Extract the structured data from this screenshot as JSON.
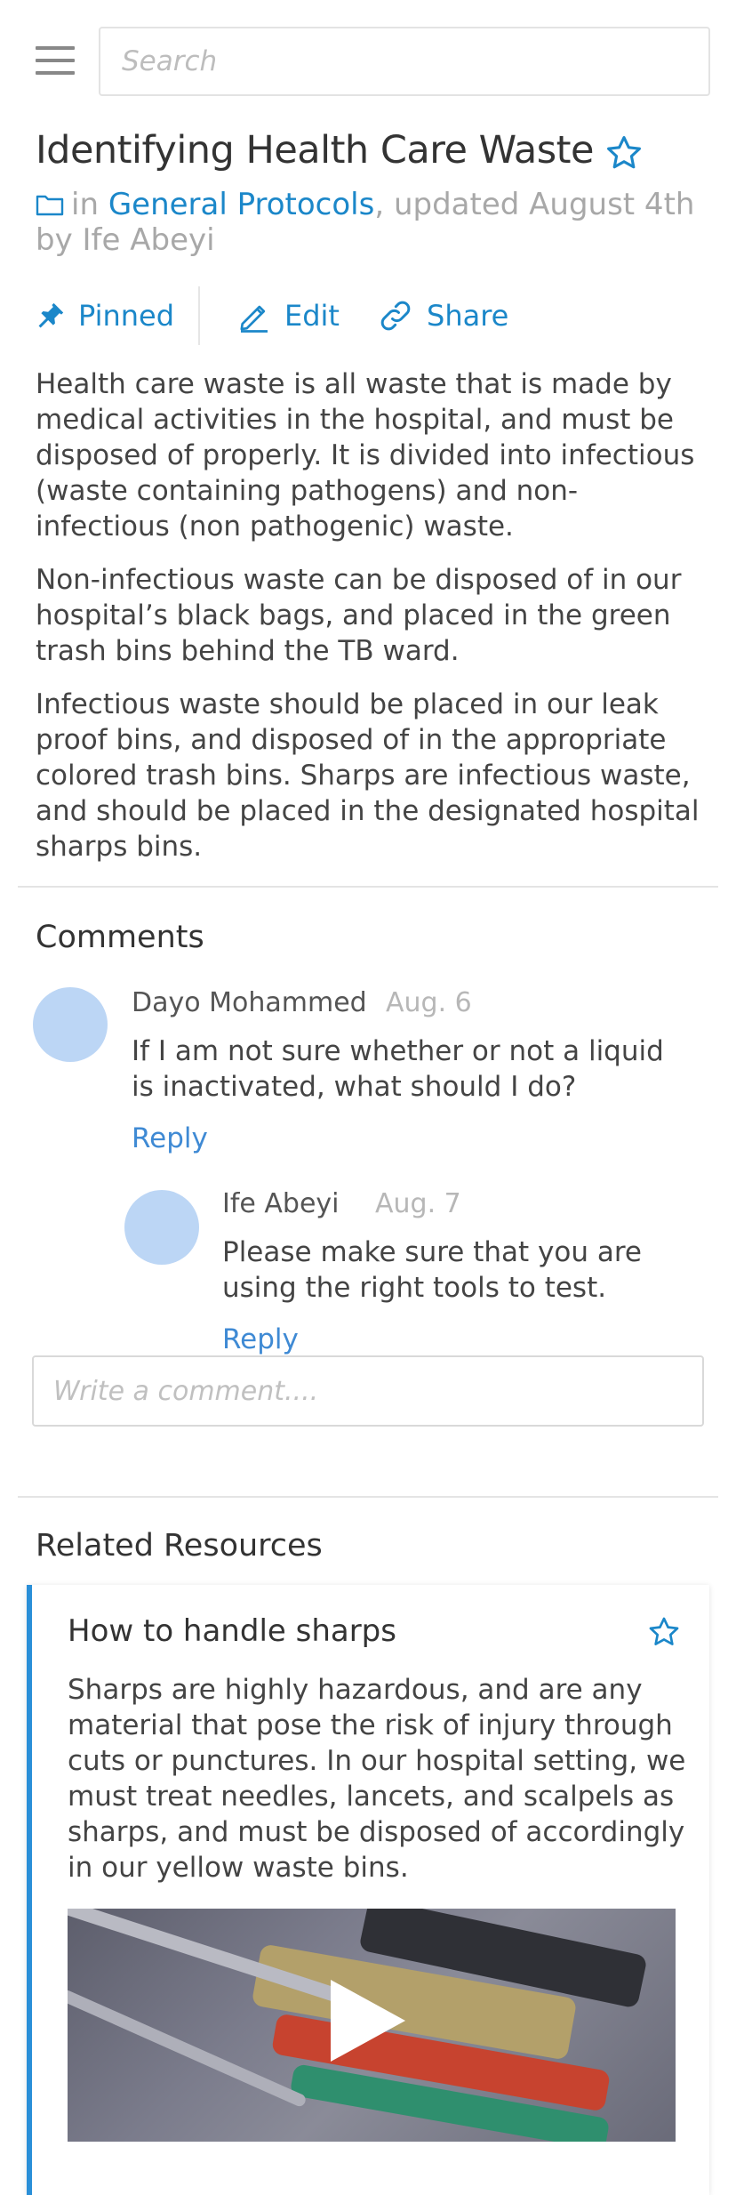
{
  "search": {
    "placeholder": "Search"
  },
  "article": {
    "title": "Identifying Health Care Waste",
    "meta_in": "in",
    "category": "General Protocols",
    "meta_updated": ", updated August 4th",
    "meta_by": "by Ife Abeyi",
    "actions": {
      "pinned": "Pinned",
      "edit": "Edit",
      "share": "Share"
    },
    "paragraphs": [
      "Health care waste is all waste that is made by medical activities in the hospital, and must be disposed of properly. It is divided into infectious (waste containing pathogens) and non-infectious (non pathogenic) waste.",
      "Non-infectious waste can be disposed of in our hospital’s black bags, and placed in the green trash bins behind the TB ward.",
      "Infectious waste should be placed in our leak proof bins, and disposed of in the appropriate colored trash bins. Sharps are infectious waste, and should be placed in the designated hospital sharps bins."
    ]
  },
  "comments": {
    "title": "Comments",
    "items": [
      {
        "author": "Dayo Mohammed",
        "date": "Aug. 6",
        "text": "If I am not sure whether or not a liquid is inactivated, what should I do?",
        "reply": "Reply"
      },
      {
        "author": "Ife Abeyi",
        "date": "Aug. 7",
        "text": "Please make sure that you are using the right tools to test.",
        "reply": "Reply"
      }
    ],
    "input_placeholder": "Write a comment...."
  },
  "related": {
    "title": "Related Resources",
    "card": {
      "title": "How to handle sharps",
      "text": "Sharps are highly hazardous, and are any material that pose the risk of injury through cuts or punctures. In our hospital setting, we must treat needles, lancets, and scalpels as sharps, and must be disposed of accordingly in our yellow waste bins."
    }
  },
  "colors": {
    "accent": "#1b87c9",
    "avatar": "#bcd6f5",
    "card_border": "#2a8fd8"
  },
  "icons": {
    "menu": "hamburger-icon",
    "star": "star-outline-icon",
    "folder": "folder-icon",
    "pin": "pin-icon",
    "edit": "pencil-icon",
    "share": "link-icon",
    "play": "play-icon"
  }
}
